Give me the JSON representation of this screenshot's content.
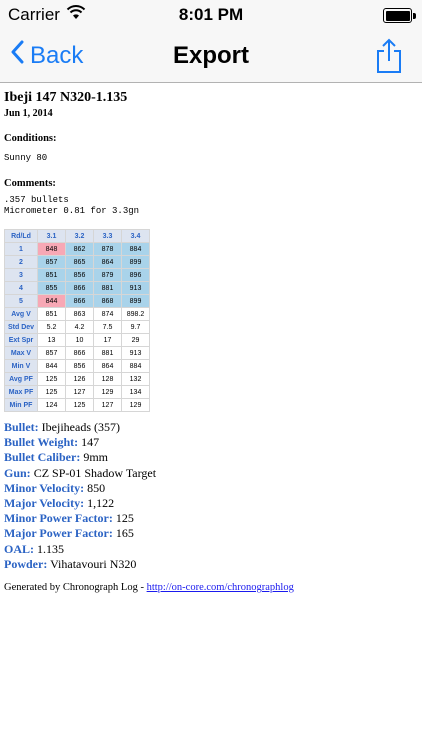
{
  "status_bar": {
    "carrier": "Carrier",
    "time": "8:01 PM"
  },
  "nav": {
    "back_label": "Back",
    "title": "Export"
  },
  "doc": {
    "title": "Ibeji 147 N320-1.135",
    "date": "Jun 1, 2014",
    "conditions_label": "Conditions:",
    "conditions": "Sunny 80",
    "comments_label": "Comments:",
    "comments": [
      ".357 bullets",
      "Micrometer 0.81 for 3.3gn"
    ]
  },
  "table": {
    "corner": "Rd/Ld",
    "headers": [
      "3.1",
      "3.2",
      "3.3",
      "3.4"
    ],
    "rounds": [
      {
        "label": "1",
        "values": [
          "848",
          "862",
          "878",
          "884"
        ]
      },
      {
        "label": "2",
        "values": [
          "857",
          "865",
          "864",
          "899"
        ]
      },
      {
        "label": "3",
        "values": [
          "851",
          "856",
          "879",
          "896"
        ]
      },
      {
        "label": "4",
        "values": [
          "855",
          "866",
          "881",
          "913"
        ]
      },
      {
        "label": "5",
        "values": [
          "844",
          "866",
          "868",
          "899"
        ]
      }
    ],
    "highlighted": [
      [
        0,
        0
      ],
      [
        4,
        0
      ]
    ],
    "stats": [
      {
        "label": "Avg V",
        "values": [
          "851",
          "863",
          "874",
          "898.2"
        ]
      },
      {
        "label": "Std Dev",
        "values": [
          "5.2",
          "4.2",
          "7.5",
          "9.7"
        ]
      },
      {
        "label": "Ext Spr",
        "values": [
          "13",
          "10",
          "17",
          "29"
        ]
      },
      {
        "label": "Max V",
        "values": [
          "857",
          "866",
          "881",
          "913"
        ]
      },
      {
        "label": "Min V",
        "values": [
          "844",
          "856",
          "864",
          "884"
        ]
      },
      {
        "label": "Avg PF",
        "values": [
          "125",
          "126",
          "128",
          "132"
        ]
      },
      {
        "label": "Max PF",
        "values": [
          "125",
          "127",
          "129",
          "134"
        ]
      },
      {
        "label": "Min PF",
        "values": [
          "124",
          "125",
          "127",
          "129"
        ]
      }
    ]
  },
  "specs": [
    {
      "key": "Bullet:",
      "value": " Ibejiheads (357)"
    },
    {
      "key": "Bullet Weight:",
      "value": " 147"
    },
    {
      "key": "Bullet Caliber:",
      "value": " 9mm"
    },
    {
      "key": "Gun:",
      "value": " CZ SP-01 Shadow Target"
    },
    {
      "key": "Minor Velocity:",
      "value": " 850"
    },
    {
      "key": "Major Velocity:",
      "value": " 1,122"
    },
    {
      "key": "Minor Power Factor:",
      "value": " 125"
    },
    {
      "key": "Major Power Factor:",
      "value": " 165"
    },
    {
      "key": "OAL:",
      "value": " 1.135"
    },
    {
      "key": "Powder:",
      "value": " Vihatavouri N320"
    }
  ],
  "footer": {
    "generated_text": "Generated by Chronograph Log - ",
    "link_text": "http://on-core.com/chronographlog"
  },
  "colors": {
    "accent": "#1a7cf5",
    "label_blue": "#2b63c4",
    "cell_blue": "#a9d3ea",
    "cell_pink": "#f7a8b5"
  }
}
